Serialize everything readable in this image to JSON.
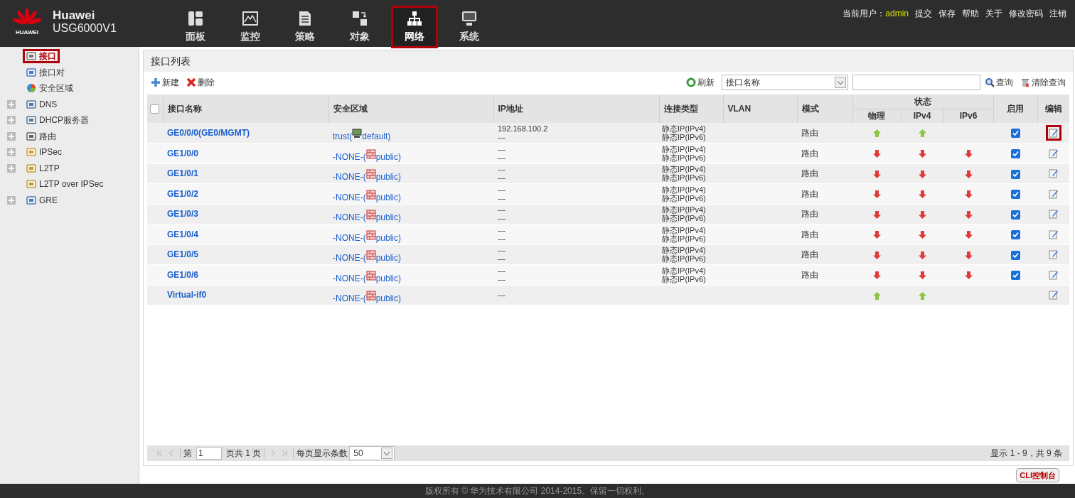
{
  "header": {
    "logo_text": "HUAWEI",
    "brand": "Huawei",
    "model": "USG6000V1",
    "nav": [
      {
        "label": "面板",
        "selected": false
      },
      {
        "label": "监控",
        "selected": false
      },
      {
        "label": "策略",
        "selected": false
      },
      {
        "label": "对象",
        "selected": false
      },
      {
        "label": "网络",
        "selected": true
      },
      {
        "label": "系统",
        "selected": false
      }
    ],
    "user_label": "当前用户：",
    "user": "admin",
    "links": [
      "提交",
      "保存",
      "帮助",
      "关于",
      "修改密码",
      "注销"
    ]
  },
  "sidebar": {
    "items": [
      {
        "label": "接口",
        "expandable": false,
        "selected": true
      },
      {
        "label": "接口对",
        "expandable": false,
        "selected": false
      },
      {
        "label": "安全区域",
        "expandable": false,
        "selected": false
      },
      {
        "label": "DNS",
        "expandable": true,
        "selected": false
      },
      {
        "label": "DHCP服务器",
        "expandable": true,
        "selected": false
      },
      {
        "label": "路由",
        "expandable": true,
        "selected": false
      },
      {
        "label": "IPSec",
        "expandable": true,
        "selected": false
      },
      {
        "label": "L2TP",
        "expandable": true,
        "selected": false
      },
      {
        "label": "L2TP over IPSec",
        "expandable": false,
        "selected": false
      },
      {
        "label": "GRE",
        "expandable": true,
        "selected": false
      }
    ]
  },
  "panel": {
    "title": "接口列表",
    "toolbar": {
      "new": "新建",
      "delete": "删除",
      "refresh": "刷新",
      "search_field": "接口名称",
      "search": "查询",
      "clear": "清除查询"
    },
    "table": {
      "select_all_checked": false,
      "columns": [
        "接口名称",
        "安全区域",
        "IP地址",
        "连接类型",
        "VLAN",
        "模式"
      ],
      "status_group": "状态",
      "status_columns": [
        "物理",
        "IPv4",
        "IPv6"
      ],
      "enable_column": "启用",
      "edit_column": "编辑",
      "rows": [
        {
          "kind": "trust",
          "name": "GE0/0/0(GE0/MGMT)",
          "zone_prefix": "trust(",
          "zone_suffix": "default)",
          "ip": [
            "192.168.100.2",
            "---"
          ],
          "conn": [
            "静态IP(IPv4)",
            "静态IP(IPv6)"
          ],
          "mode": "路由",
          "physical_up": true,
          "ipv4_up": true,
          "enabled": true,
          "edit_highlighted": true
        },
        {
          "kind": "none",
          "name": "GE1/0/0",
          "zone_prefix": "-NONE-(",
          "zone_suffix": "public)",
          "ip": [
            "---",
            "---"
          ],
          "conn": [
            "静态IP(IPv4)",
            "静态IP(IPv6)"
          ],
          "mode": "路由",
          "physical_up": false,
          "ipv4_up": false,
          "ipv6_up": false,
          "enabled": true,
          "edit_highlighted": false
        },
        {
          "kind": "none",
          "name": "GE1/0/1",
          "zone_prefix": "-NONE-(",
          "zone_suffix": "public)",
          "ip": [
            "---",
            "---"
          ],
          "conn": [
            "静态IP(IPv4)",
            "静态IP(IPv6)"
          ],
          "mode": "路由",
          "physical_up": false,
          "ipv4_up": false,
          "ipv6_up": false,
          "enabled": true,
          "edit_highlighted": false
        },
        {
          "kind": "none",
          "name": "GE1/0/2",
          "zone_prefix": "-NONE-(",
          "zone_suffix": "public)",
          "ip": [
            "---",
            "---"
          ],
          "conn": [
            "静态IP(IPv4)",
            "静态IP(IPv6)"
          ],
          "mode": "路由",
          "physical_up": false,
          "ipv4_up": false,
          "ipv6_up": false,
          "enabled": true,
          "edit_highlighted": false
        },
        {
          "kind": "none",
          "name": "GE1/0/3",
          "zone_prefix": "-NONE-(",
          "zone_suffix": "public)",
          "ip": [
            "---",
            "---"
          ],
          "conn": [
            "静态IP(IPv4)",
            "静态IP(IPv6)"
          ],
          "mode": "路由",
          "physical_up": false,
          "ipv4_up": false,
          "ipv6_up": false,
          "enabled": true,
          "edit_highlighted": false
        },
        {
          "kind": "none",
          "name": "GE1/0/4",
          "zone_prefix": "-NONE-(",
          "zone_suffix": "public)",
          "ip": [
            "---",
            "---"
          ],
          "conn": [
            "静态IP(IPv4)",
            "静态IP(IPv6)"
          ],
          "mode": "路由",
          "physical_up": false,
          "ipv4_up": false,
          "ipv6_up": false,
          "enabled": true,
          "edit_highlighted": false
        },
        {
          "kind": "none",
          "name": "GE1/0/5",
          "zone_prefix": "-NONE-(",
          "zone_suffix": "public)",
          "ip": [
            "---",
            "---"
          ],
          "conn": [
            "静态IP(IPv4)",
            "静态IP(IPv6)"
          ],
          "mode": "路由",
          "physical_up": false,
          "ipv4_up": false,
          "ipv6_up": false,
          "enabled": true,
          "edit_highlighted": false
        },
        {
          "kind": "none",
          "name": "GE1/0/6",
          "zone_prefix": "-NONE-(",
          "zone_suffix": "public)",
          "ip": [
            "---",
            "---"
          ],
          "conn": [
            "静态IP(IPv4)",
            "静态IP(IPv6)"
          ],
          "mode": "路由",
          "physical_up": false,
          "ipv4_up": false,
          "ipv6_up": false,
          "enabled": true,
          "edit_highlighted": false
        },
        {
          "kind": "none",
          "name": "Virtual-if0",
          "zone_prefix": "-NONE-(",
          "zone_suffix": "public)",
          "ip": [
            "---"
          ],
          "physical_up": true,
          "ipv4_up": true,
          "edit_highlighted": false
        }
      ]
    },
    "pager": {
      "page_prefix": "第",
      "page": "1",
      "page_suffix": "页共 1 页",
      "per_page_label": "每页显示条数",
      "per_page": "50",
      "summary": "显示 1 - 9，共 9 条"
    }
  },
  "cli_button": "CLI控制台",
  "footer": "版权所有 © 华为技术有限公司 2014-2015。保留一切权利。"
}
